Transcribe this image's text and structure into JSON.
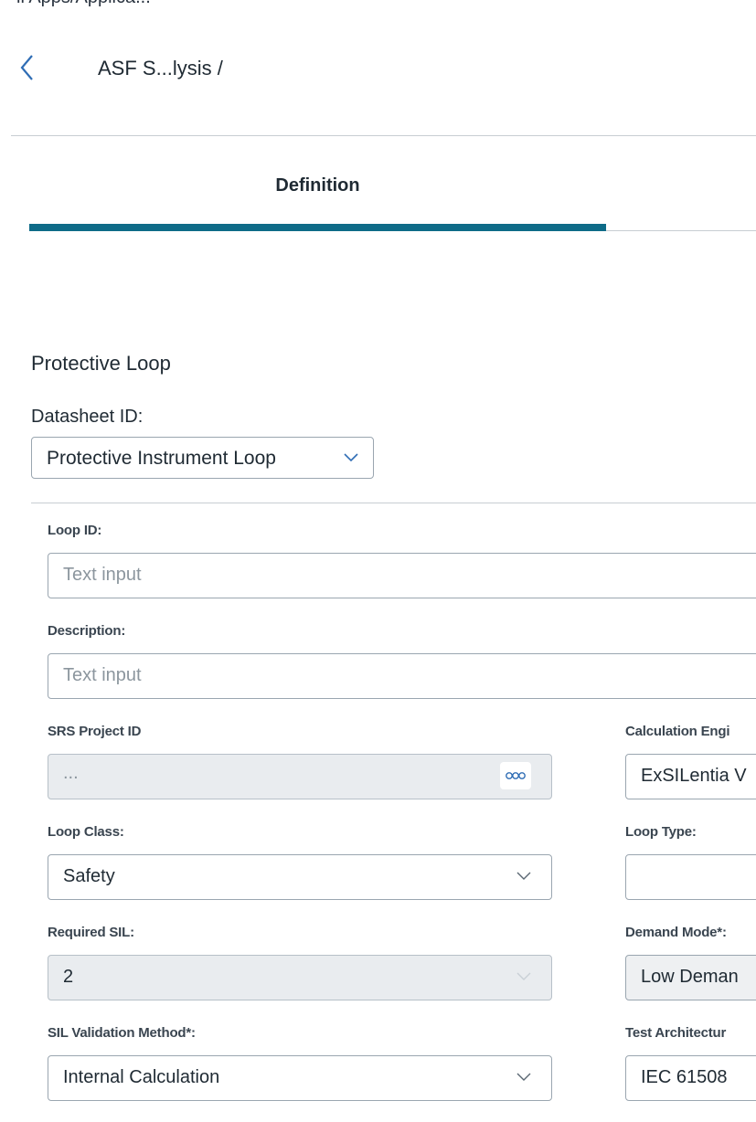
{
  "app": {
    "title_fragment": "ll Apps/Applica..."
  },
  "header": {
    "breadcrumb": "ASF S...lysis /"
  },
  "tabs": [
    {
      "label": "Definition",
      "active": true
    }
  ],
  "section": {
    "title": "Protective Loop"
  },
  "datasheet": {
    "label": "Datasheet ID:",
    "selected": "Protective Instrument Loop"
  },
  "fields": {
    "loop_id": {
      "label": "Loop ID:",
      "placeholder": "Text input",
      "value": ""
    },
    "description": {
      "label": "Description:",
      "placeholder": "Text input",
      "value": ""
    },
    "srs_project_id": {
      "label": "SRS Project ID",
      "value": "..."
    },
    "calculation_engine": {
      "label": "Calculation Engi",
      "value": "ExSILentia V"
    },
    "loop_class": {
      "label": "Loop Class:",
      "value": "Safety"
    },
    "loop_type": {
      "label": "Loop Type:",
      "value": ""
    },
    "required_sil": {
      "label": "Required SIL:",
      "value": "2"
    },
    "demand_mode": {
      "label": "Demand Mode*:",
      "value": "Low Deman"
    },
    "sil_validation_method": {
      "label": "SIL Validation Method*:",
      "value": "Internal Calculation"
    },
    "test_architecture": {
      "label": "Test Architectur",
      "value": "IEC 61508"
    }
  },
  "icons": {
    "back": "chevron-left-icon",
    "dropdown": "chevron-down-icon",
    "more": "ellipsis-icon"
  },
  "colors": {
    "accent": "#0e6b88",
    "link": "#2f6db5",
    "border": "#9aa6b0",
    "disabled_bg": "#e9ecef"
  }
}
